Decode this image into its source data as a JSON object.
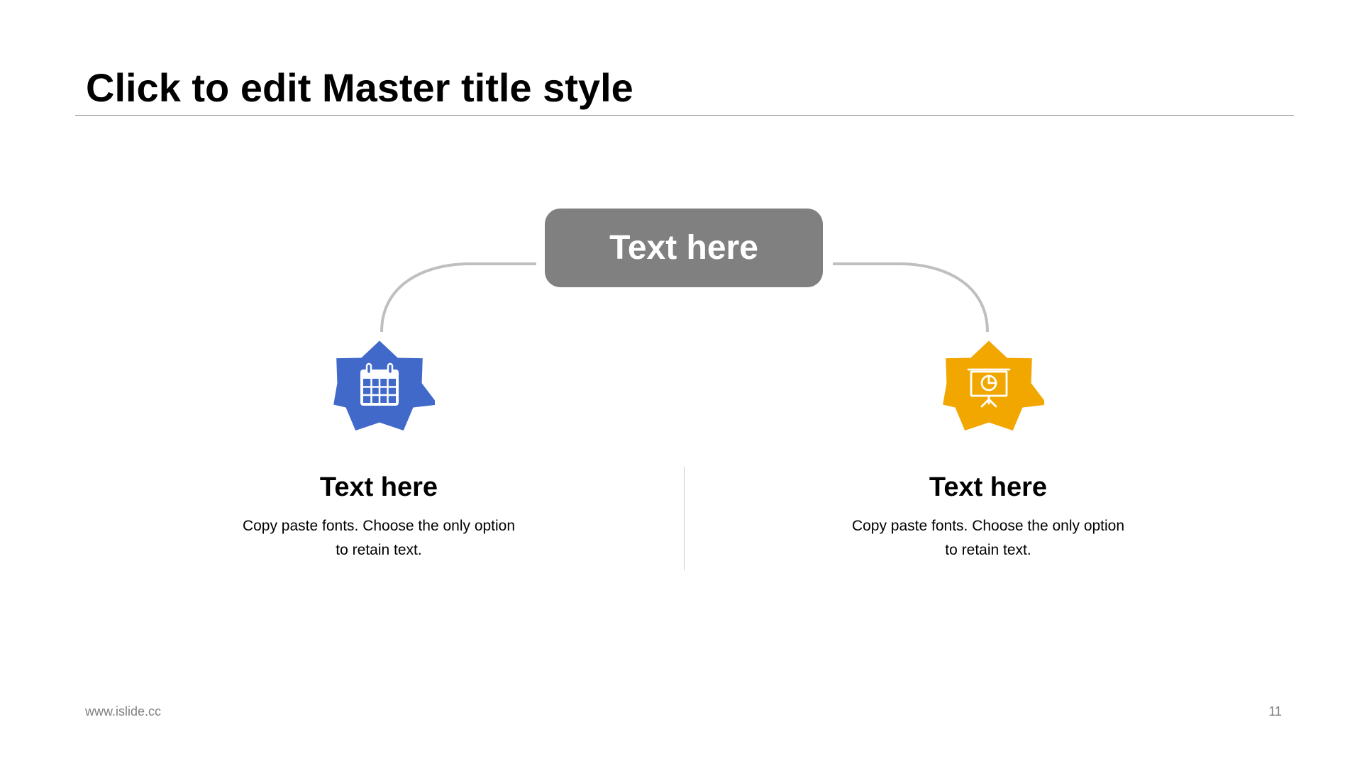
{
  "slide": {
    "title": "Click to edit Master title style",
    "center_label": "Text here",
    "footer_url": "www.islide.cc",
    "page_number": "11"
  },
  "items": [
    {
      "heading": "Text here",
      "description": "Copy paste fonts. Choose the only option to retain text.",
      "icon": "calendar-icon",
      "color": "#4169c9"
    },
    {
      "heading": "Text here",
      "description": "Copy paste fonts. Choose the only option to retain text.",
      "icon": "presentation-board-icon",
      "color": "#f2a600"
    }
  ],
  "colors": {
    "center_box": "#808080",
    "connector": "#bfbfbf"
  }
}
